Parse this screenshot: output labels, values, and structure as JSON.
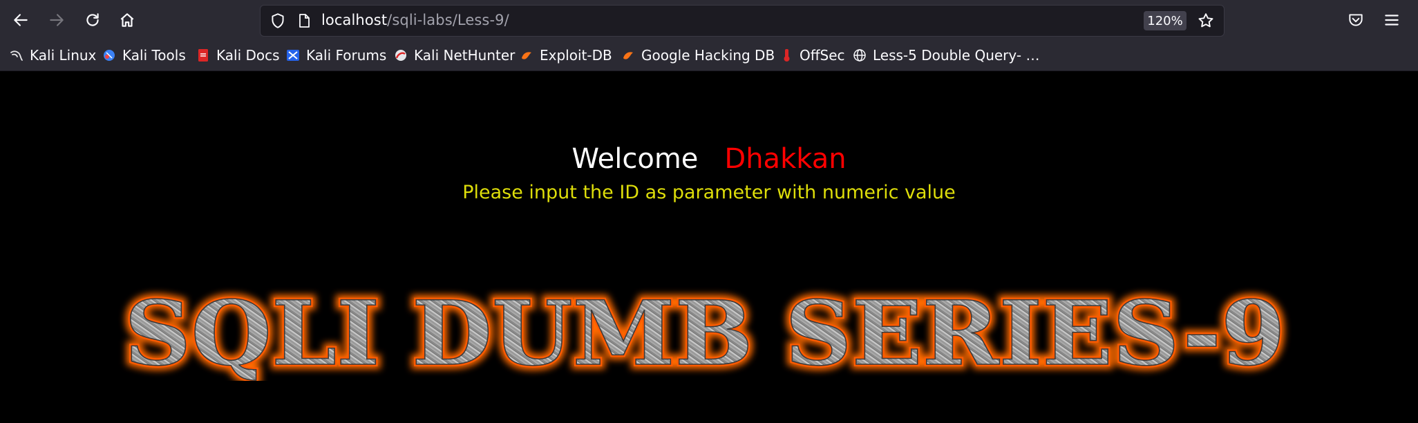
{
  "browser": {
    "url_host": "localhost",
    "url_path": "/sqli-labs/Less-9/",
    "zoom": "120%"
  },
  "bookmarks": [
    {
      "label": "Kali Linux",
      "icon": "kali-dragon-icon"
    },
    {
      "label": "Kali Tools",
      "icon": "kali-tools-icon"
    },
    {
      "label": "Kali Docs",
      "icon": "kali-docs-icon"
    },
    {
      "label": "Kali Forums",
      "icon": "kali-forums-icon"
    },
    {
      "label": "Kali NetHunter",
      "icon": "kali-nethunter-icon"
    },
    {
      "label": "Exploit-DB",
      "icon": "exploit-db-icon"
    },
    {
      "label": "Google Hacking DB",
      "icon": "ghdb-icon"
    },
    {
      "label": "OffSec",
      "icon": "offsec-icon"
    },
    {
      "label": "Less-5 Double Query- …",
      "icon": "globe-icon"
    }
  ],
  "page": {
    "welcome": "Welcome",
    "name": "Dhakkan",
    "hint": "Please input the ID as parameter with numeric value",
    "banner": "SQLI DUMB SERIES-9"
  },
  "colors": {
    "welcome": "#ffffff",
    "name": "#ff0000",
    "hint": "#dede0a",
    "banner_glow": "#ff6a00"
  }
}
